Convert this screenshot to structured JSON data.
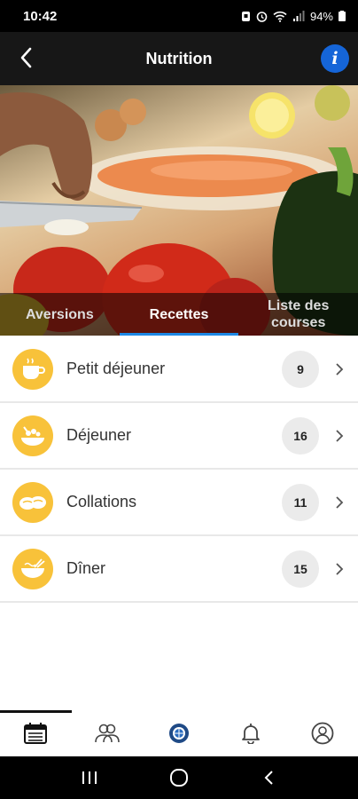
{
  "status_bar": {
    "time": "10:42",
    "battery": "94%",
    "icons": [
      "notification-icon",
      "alarm-icon",
      "wifi-icon",
      "signal-icon",
      "battery-icon"
    ]
  },
  "header": {
    "title": "Nutrition",
    "back_icon": "chevron-left-icon",
    "info_label": "i"
  },
  "tabs": [
    {
      "label": "Aversions",
      "active": false
    },
    {
      "label": "Recettes",
      "active": true
    },
    {
      "label": "Liste des courses",
      "active": false
    }
  ],
  "recipes": {
    "items": [
      {
        "label": "Petit déjeuner",
        "count": "9",
        "icon": "coffee-cup-icon"
      },
      {
        "label": "Déjeuner",
        "count": "16",
        "icon": "lunch-plate-icon"
      },
      {
        "label": "Collations",
        "count": "11",
        "icon": "snack-icon"
      },
      {
        "label": "Dîner",
        "count": "15",
        "icon": "dinner-bowl-icon"
      }
    ]
  },
  "bottom_nav": {
    "items": [
      {
        "name": "calendar-icon",
        "active": true
      },
      {
        "name": "group-icon",
        "active": false
      },
      {
        "name": "globe-logo-icon",
        "active": false
      },
      {
        "name": "bell-icon",
        "active": false
      },
      {
        "name": "profile-icon",
        "active": false
      }
    ]
  },
  "colors": {
    "accent": "#f8c23a",
    "header_bg": "#171717",
    "tab_indicator": "#1e88e5",
    "info_blue": "#1565d8"
  }
}
